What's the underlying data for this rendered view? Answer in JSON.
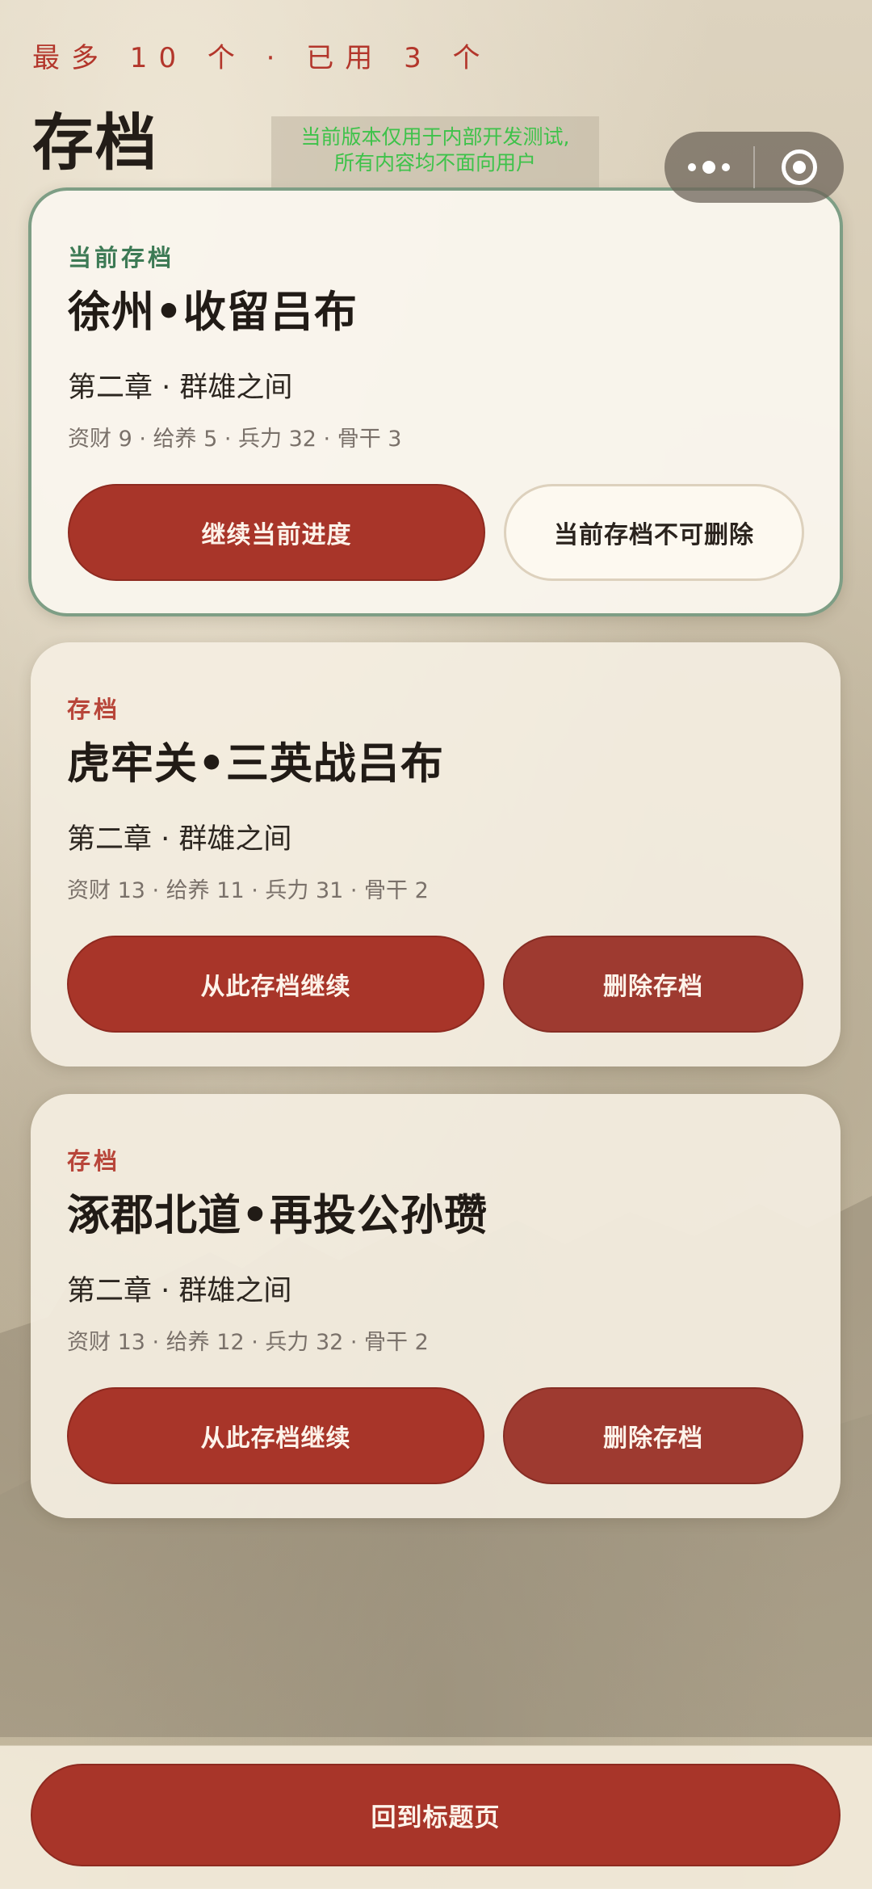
{
  "header": {
    "counter": "最多 10 个 · 已用 3 个",
    "title": "存档"
  },
  "dev_notice": {
    "line1": "当前版本仅用于内部开发测试,",
    "line2": "所有内容均不面向用户"
  },
  "capsule": {
    "more_icon": "more-dots-icon",
    "close_icon": "target-close-icon"
  },
  "saves": [
    {
      "tag": "当前存档",
      "title": "徐州•收留吕布",
      "chapter": "第二章 · 群雄之间",
      "stats": "资财 9 · 给养 5 · 兵力 32 · 骨干 3",
      "primary_label": "继续当前进度",
      "secondary_label": "当前存档不可删除"
    },
    {
      "tag": "存档",
      "title": "虎牢关•三英战吕布",
      "chapter": "第二章 · 群雄之间",
      "stats": "资财 13 · 给养 11 · 兵力 31 · 骨干 2",
      "primary_label": "从此存档继续",
      "secondary_label": "删除存档"
    },
    {
      "tag": "存档",
      "title": "涿郡北道•再投公孙瓒",
      "chapter": "第二章 · 群雄之间",
      "stats": "资财 13 · 给养 12 · 兵力 32 · 骨干 2",
      "primary_label": "从此存档继续",
      "secondary_label": "删除存档"
    }
  ],
  "footer": {
    "back_label": "回到标题页"
  },
  "colors": {
    "accent_red": "#a83529",
    "current_green": "#3d7a55",
    "notice_green": "#3ec24a"
  }
}
